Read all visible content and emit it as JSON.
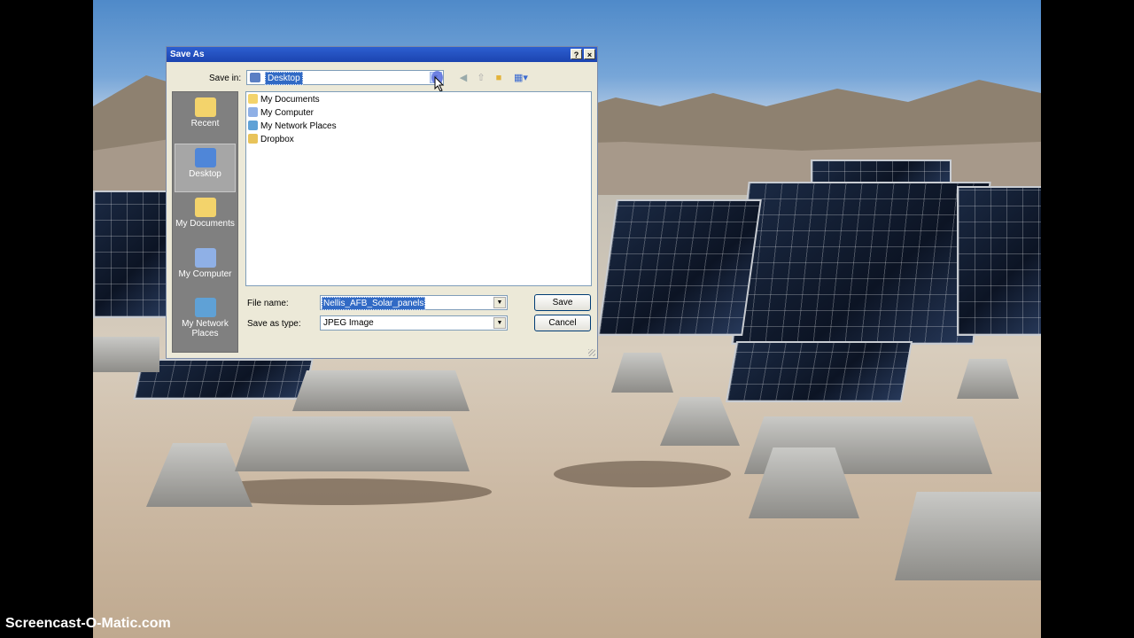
{
  "dialog": {
    "title": "Save As",
    "help_label": "?",
    "close_label": "×",
    "save_in_label": "Save in:",
    "save_in_value": "Desktop",
    "places": [
      {
        "label": "Recent",
        "icon": "folder-icon"
      },
      {
        "label": "Desktop",
        "icon": "desktop-icon"
      },
      {
        "label": "My Documents",
        "icon": "documents-icon"
      },
      {
        "label": "My Computer",
        "icon": "computer-icon"
      },
      {
        "label": "My Network Places",
        "icon": "network-icon"
      }
    ],
    "files": [
      {
        "label": "My Documents",
        "icon": "documents-icon"
      },
      {
        "label": "My Computer",
        "icon": "computer-icon"
      },
      {
        "label": "My Network Places",
        "icon": "network-icon"
      },
      {
        "label": "Dropbox",
        "icon": "dropbox-folder-icon"
      }
    ],
    "file_name_label": "File name:",
    "file_name_value": "Nellis_AFB_Solar_panels",
    "save_as_type_label": "Save as type:",
    "save_as_type_value": "JPEG Image",
    "save_button": "Save",
    "cancel_button": "Cancel"
  },
  "watermark": "Screencast-O-Matic.com"
}
